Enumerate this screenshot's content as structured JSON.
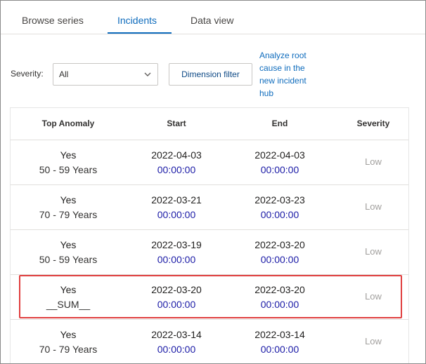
{
  "tabs": [
    {
      "label": "Browse series"
    },
    {
      "label": "Incidents",
      "active": true
    },
    {
      "label": "Data view"
    }
  ],
  "filters": {
    "severity_label": "Severity:",
    "severity_value": "All",
    "dimension_button": "Dimension filter",
    "analyze_link": "Analyze root cause in the new incident hub"
  },
  "table": {
    "headers": [
      "Top Anomaly",
      "Start",
      "End",
      "Severity"
    ],
    "rows": [
      {
        "anomaly": "Yes",
        "group": "50 - 59 Years",
        "start_date": "2022-04-03",
        "start_time": "00:00:00",
        "end_date": "2022-04-03",
        "end_time": "00:00:00",
        "severity": "Low"
      },
      {
        "anomaly": "Yes",
        "group": "70 - 79 Years",
        "start_date": "2022-03-21",
        "start_time": "00:00:00",
        "end_date": "2022-03-23",
        "end_time": "00:00:00",
        "severity": "Low"
      },
      {
        "anomaly": "Yes",
        "group": "50 - 59 Years",
        "start_date": "2022-03-19",
        "start_time": "00:00:00",
        "end_date": "2022-03-20",
        "end_time": "00:00:00",
        "severity": "Low"
      },
      {
        "anomaly": "Yes",
        "group": "__SUM__",
        "start_date": "2022-03-20",
        "start_time": "00:00:00",
        "end_date": "2022-03-20",
        "end_time": "00:00:00",
        "severity": "Low"
      },
      {
        "anomaly": "Yes",
        "group": "70 - 79 Years",
        "start_date": "2022-03-14",
        "start_time": "00:00:00",
        "end_date": "2022-03-14",
        "end_time": "00:00:00",
        "severity": "Low"
      }
    ]
  },
  "colors": {
    "accent": "#0f6cbd",
    "time_text": "#1a1aa6",
    "highlight_border": "#e03e3e",
    "severity_text": "#a19f9d"
  }
}
